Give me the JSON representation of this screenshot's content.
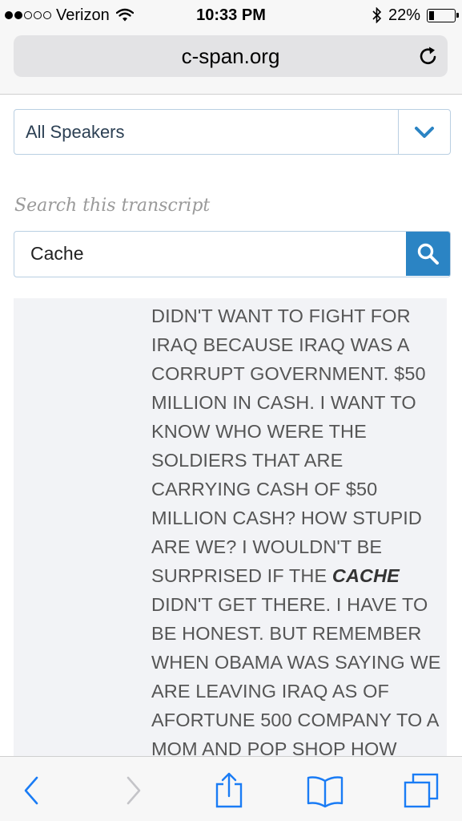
{
  "status_bar": {
    "signal_dots_filled": 2,
    "signal_dots_total": 5,
    "carrier": "Verizon",
    "time": "10:33 PM",
    "battery_percent": "22%",
    "battery_level": 0.22
  },
  "browser": {
    "url": "c-span.org"
  },
  "filters": {
    "speaker_selected": "All Speakers"
  },
  "search": {
    "caption": "Search this transcript",
    "value": "Cache"
  },
  "transcript": {
    "before_highlight": "DIDN'T WANT TO FIGHT FOR IRAQ BECAUSE IRAQ WAS A CORRUPT GOVERNMENT. $50 MILLION IN CASH. I WANT TO KNOW WHO WERE THE SOLDIERS THAT ARE CARRYING CASH OF $50 MILLION CASH? HOW STUPID ARE WE? I WOULDN'T BE SURPRISED IF THE",
    "highlight": "CACHE",
    "after_highlight": "DIDN'T GET THERE. I HAVE TO BE HONEST. BUT REMEMBER WHEN OBAMA WAS SAYING WE ARE LEAVING IRAQ AS OF AFORTUNE 500 COMPANY TO A MOM AND POP SHOP HOW"
  },
  "colors": {
    "accent_blue": "#2b84c4",
    "toolbar_icon_blue": "#1a7cf5",
    "field_border": "#b9cfe2"
  },
  "toolbar": {
    "icons": [
      "back-icon",
      "forward-icon",
      "share-icon",
      "bookmarks-icon",
      "tabs-icon"
    ]
  }
}
